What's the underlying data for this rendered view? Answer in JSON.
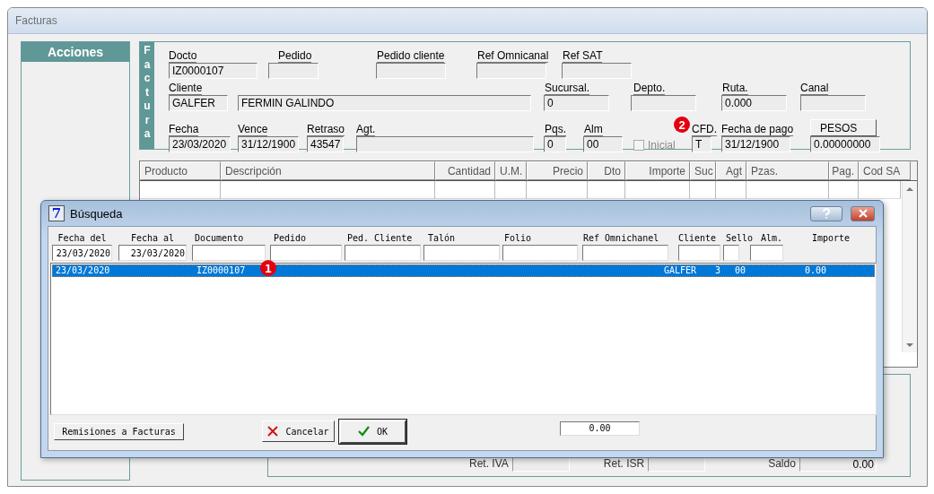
{
  "window": {
    "title": "Facturas"
  },
  "actions_panel": {
    "title": "Acciones"
  },
  "factura": {
    "side_label": "Factura",
    "lines": [
      {
        "fields": [
          {
            "kind": "field",
            "label": "Docto",
            "value": "IZ0000107"
          },
          {
            "kind": "field",
            "label": "Pedido"
          },
          {
            "kind": "field",
            "label": "Pedido cliente"
          },
          {
            "kind": "field",
            "label": "Ref Omnicanal"
          },
          {
            "kind": "field",
            "label": "Ref SAT"
          }
        ]
      },
      {
        "fields": [
          {
            "kind": "field",
            "label": "Cliente",
            "value": "GALFER"
          },
          {
            "kind": "field",
            "value": "FERMIN GALINDO"
          },
          {
            "kind": "field",
            "label": "Sucursal.",
            "value": "0"
          },
          {
            "kind": "field",
            "label": "Depto."
          },
          {
            "kind": "field",
            "label": "Ruta.",
            "value": "0.000"
          },
          {
            "kind": "field",
            "label": "Canal"
          }
        ]
      },
      {
        "fields": [
          {
            "kind": "field",
            "label": "Fecha",
            "value": "23/03/2020"
          },
          {
            "kind": "field",
            "label": "Vence",
            "value": "31/12/1900"
          },
          {
            "kind": "field",
            "label": "Retraso",
            "value": "43547"
          },
          {
            "kind": "field",
            "label": "Agt."
          },
          {
            "kind": "field",
            "label": "Pqs.",
            "value": "0"
          },
          {
            "kind": "field",
            "label": "Alm",
            "value": "00"
          },
          {
            "kind": "checkbox",
            "label": "Inicial",
            "checked": false,
            "disabled": true
          },
          {
            "kind": "field",
            "label": "CFD.",
            "value": "T",
            "marker": "2"
          },
          {
            "kind": "field",
            "label": "Fecha de pago",
            "value": "31/12/1900"
          },
          {
            "kind": "button_field",
            "button": "PESOS",
            "value": "0.00000000"
          }
        ]
      }
    ]
  },
  "table": {
    "columns": [
      "Producto",
      "Descripción",
      "Cantidad",
      "U.M.",
      "Precio",
      "Dto",
      "Importe",
      "Suc",
      "Agt",
      "Pzas.",
      "Pag.",
      "Cod SA"
    ]
  },
  "totals": [
    {
      "label": "Ret. IVA"
    },
    {
      "label": "Ret. ISR"
    },
    {
      "label": "Saldo",
      "value": "0.00"
    }
  ],
  "dialog": {
    "icon_text": "7",
    "title": "Búsqueda",
    "filters": [
      {
        "label": "Fecha del",
        "value": "23/03/2020"
      },
      {
        "label": "Fecha al",
        "value": "23/03/2020"
      },
      {
        "label": "Documento",
        "marker": "1"
      },
      {
        "label": "Pedido"
      },
      {
        "label": "Ped. Cliente"
      },
      {
        "label": "Talón"
      },
      {
        "label": "Folio"
      },
      {
        "label": "Ref Omnichanel"
      },
      {
        "label": "Cliente"
      },
      {
        "label": "Sello"
      },
      {
        "label": "Alm."
      },
      {
        "label": "Importe",
        "kind": "label_only"
      }
    ],
    "rows": [
      {
        "selected": true,
        "cells": [
          "23/03/2020",
          "IZ0000107",
          "GALFER",
          "3",
          "00",
          "0.00"
        ]
      }
    ],
    "buttons": [
      "Remisiones a Facturas",
      "Cancelar",
      "OK"
    ],
    "total": "0.00"
  }
}
